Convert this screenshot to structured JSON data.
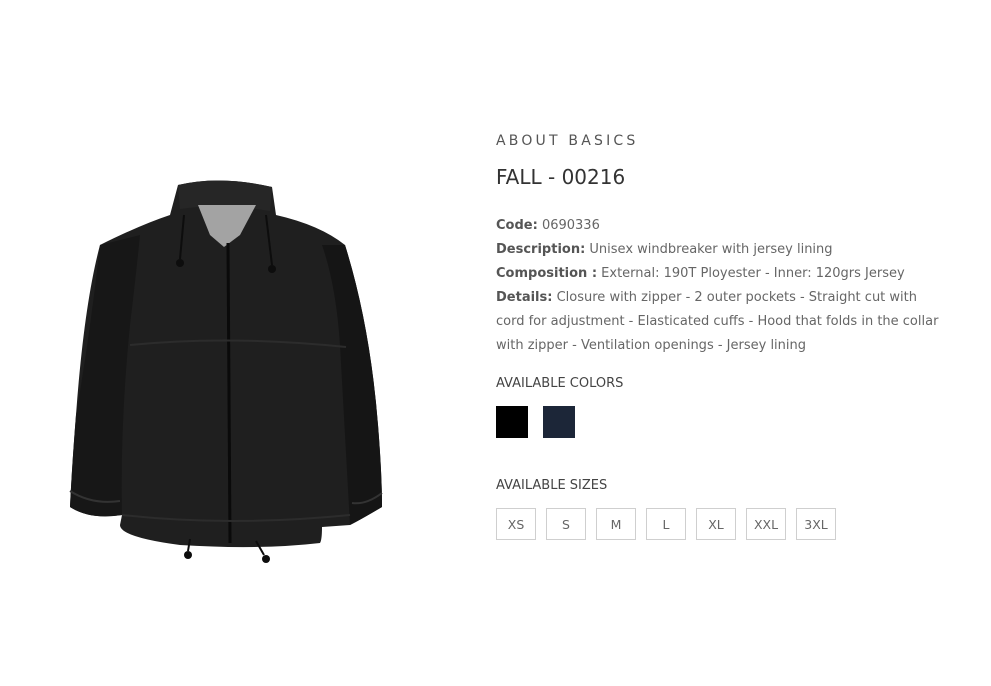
{
  "product": {
    "brand": "ABOUT BASICS",
    "title": "FALL - 00216",
    "code_key": "Code:",
    "code_value": "0690336",
    "description_key": "Description:",
    "description_value": "Unisex windbreaker with jersey lining",
    "composition_key": "Composition :",
    "composition_value": "External: 190T Ployester - Inner: 120grs Jersey",
    "details_key": "Details:",
    "details_value": "Closure with zipper - 2 outer pockets - Straight cut with cord for adjustment - Elasticated cuffs - Hood that folds in the collar with zipper - Ventilation openings - Jersey lining"
  },
  "colors": {
    "title": "AVAILABLE COLORS",
    "swatches": [
      {
        "name": "black",
        "hex": "#000000"
      },
      {
        "name": "navy",
        "hex": "#1c2638"
      }
    ]
  },
  "sizes": {
    "title": "AVAILABLE SIZES",
    "options": [
      "XS",
      "S",
      "M",
      "L",
      "XL",
      "XXL",
      "3XL"
    ]
  },
  "image": {
    "icon": "windbreaker-jacket-photo",
    "jacket_color": "#1e1e1e",
    "lining_color": "#9a9a9a"
  }
}
